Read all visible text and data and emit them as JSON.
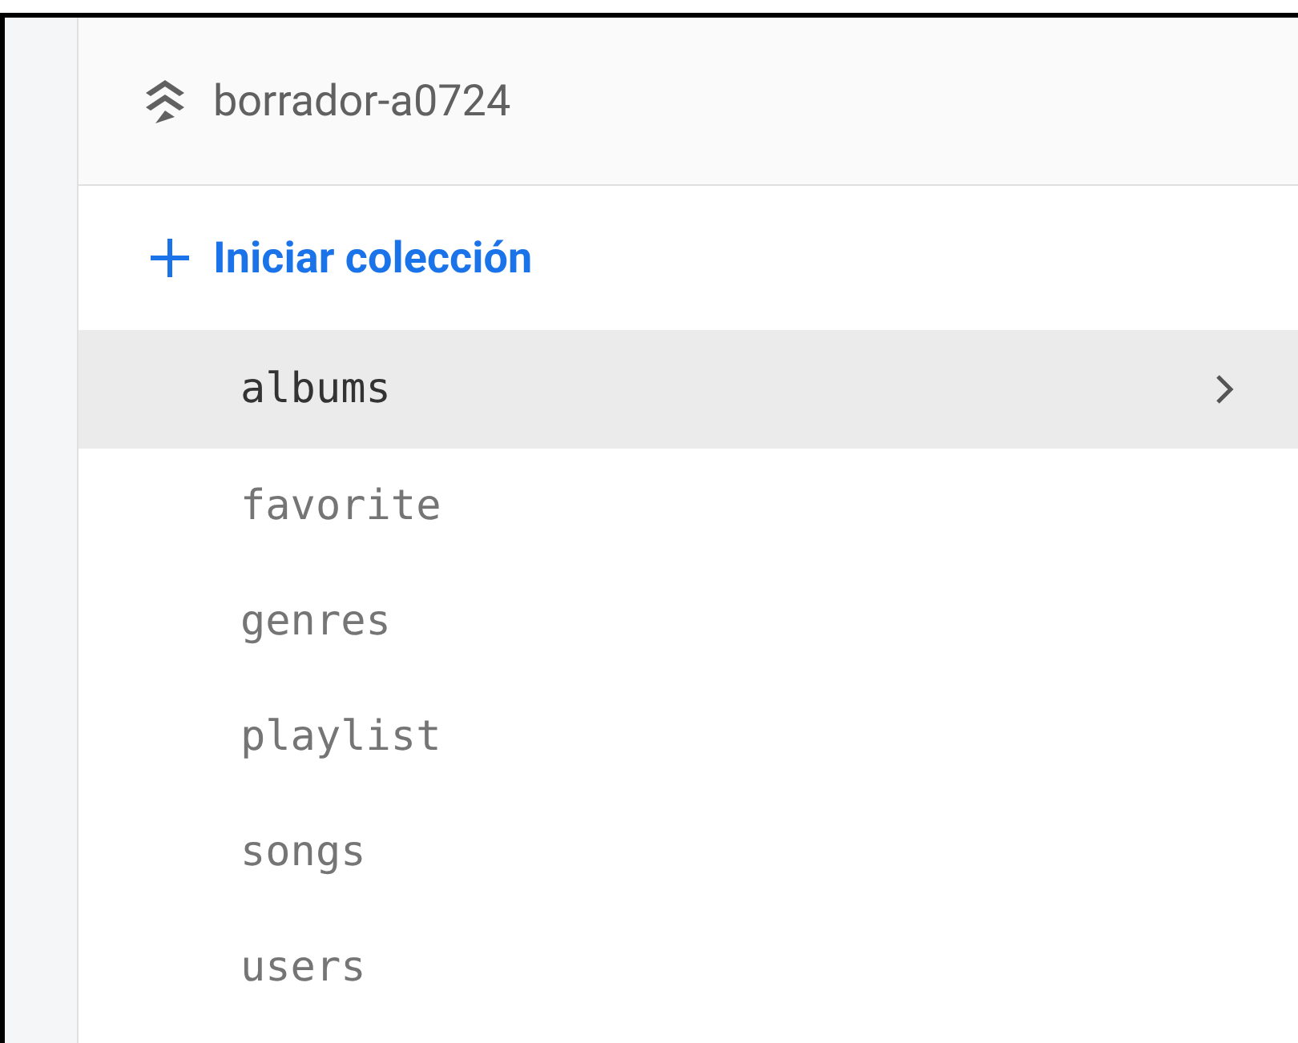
{
  "project": {
    "name": "borrador-a0724"
  },
  "add_collection": {
    "label": "Iniciar colección"
  },
  "collections": [
    {
      "name": "albums",
      "selected": true
    },
    {
      "name": "favorite",
      "selected": false
    },
    {
      "name": "genres",
      "selected": false
    },
    {
      "name": "playlist",
      "selected": false
    },
    {
      "name": "songs",
      "selected": false
    },
    {
      "name": "users",
      "selected": false
    }
  ]
}
